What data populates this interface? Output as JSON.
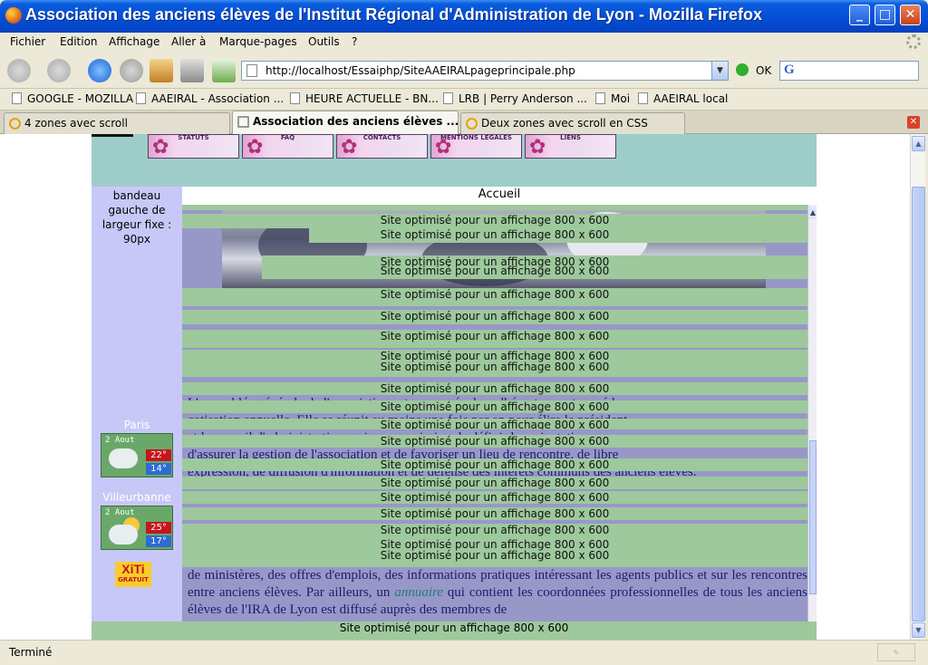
{
  "window": {
    "title": "Association des anciens élèves de l'Institut Régional d'Administration de Lyon - Mozilla Firefox",
    "minimize": "_",
    "maximize": "□",
    "close": "✕"
  },
  "menu": [
    {
      "label": "Fichier"
    },
    {
      "label": "Edition"
    },
    {
      "label": "Affichage"
    },
    {
      "label": "Aller à"
    },
    {
      "label": "Marque-pages"
    },
    {
      "label": "Outils"
    },
    {
      "label": "?"
    }
  ],
  "nav": {
    "url": "http://localhost/Essaiphp/SiteAAEIRALpageprincipale.php",
    "go_label": "OK",
    "search_logo": "G"
  },
  "bookmarks": [
    {
      "label": "GOOGLE - MOZILLA"
    },
    {
      "label": "AAEIRAL - Association ..."
    },
    {
      "label": "HEURE ACTUELLE - BN..."
    },
    {
      "label": "LRB | Perry Anderson ..."
    },
    {
      "label": "Moi"
    },
    {
      "label": "AAEIRAL local"
    }
  ],
  "tabs": [
    {
      "label": "4 zones avec scroll"
    },
    {
      "label": "Association des anciens élèves ..."
    },
    {
      "label": "Deux zones avec scroll en CSS"
    }
  ],
  "site": {
    "nav_tiles": [
      {
        "label": "STATUTS"
      },
      {
        "label": "FAQ"
      },
      {
        "label": "CONTACTS"
      },
      {
        "label": "MENTIONS LEGALES"
      },
      {
        "label": "LIENS"
      }
    ],
    "left_band_text": "bandeau gauche de largeur fixe : 90px",
    "weather": [
      {
        "city": "Paris",
        "date": "2 Aout",
        "high": "22°",
        "low": "14°"
      },
      {
        "city": "Villeurbanne",
        "date": "2 Aout",
        "high": "25°",
        "low": "17°"
      }
    ],
    "xiti": {
      "name": "XiTi",
      "sub": "GRATUIT"
    },
    "main_title": "Accueil",
    "optim_text": "Site optimisé pour un affichage 800 x 600",
    "para_partial": [
      "L'assemblée générale de l'association est composée des adhérents ayant versé leur",
      "cotisation annuelle. Elle se réunit au moins une fois par an pour élire le président",
      "et le conseil d'administration, qui a pour mission de définir les orientations,",
      "d'assurer la gestion de l'association et de favoriser un lieu de rencontre, de libre",
      "expression, de diffusion d'information et de défense des intérêts communs des anciens élèves."
    ],
    "para_1": "de ministères, des offres d'emplois, des informations pratiques intéressant les agents publics et sur les rencontres entre anciens élèves. Par ailleurs, un",
    "para_link": "annuaire",
    "para_2": "qui contient les coordonnées professionnelles de tous les anciens élèves de l'IRA de Lyon est diffusé auprès des membres de"
  },
  "status": {
    "text": "Terminé"
  }
}
